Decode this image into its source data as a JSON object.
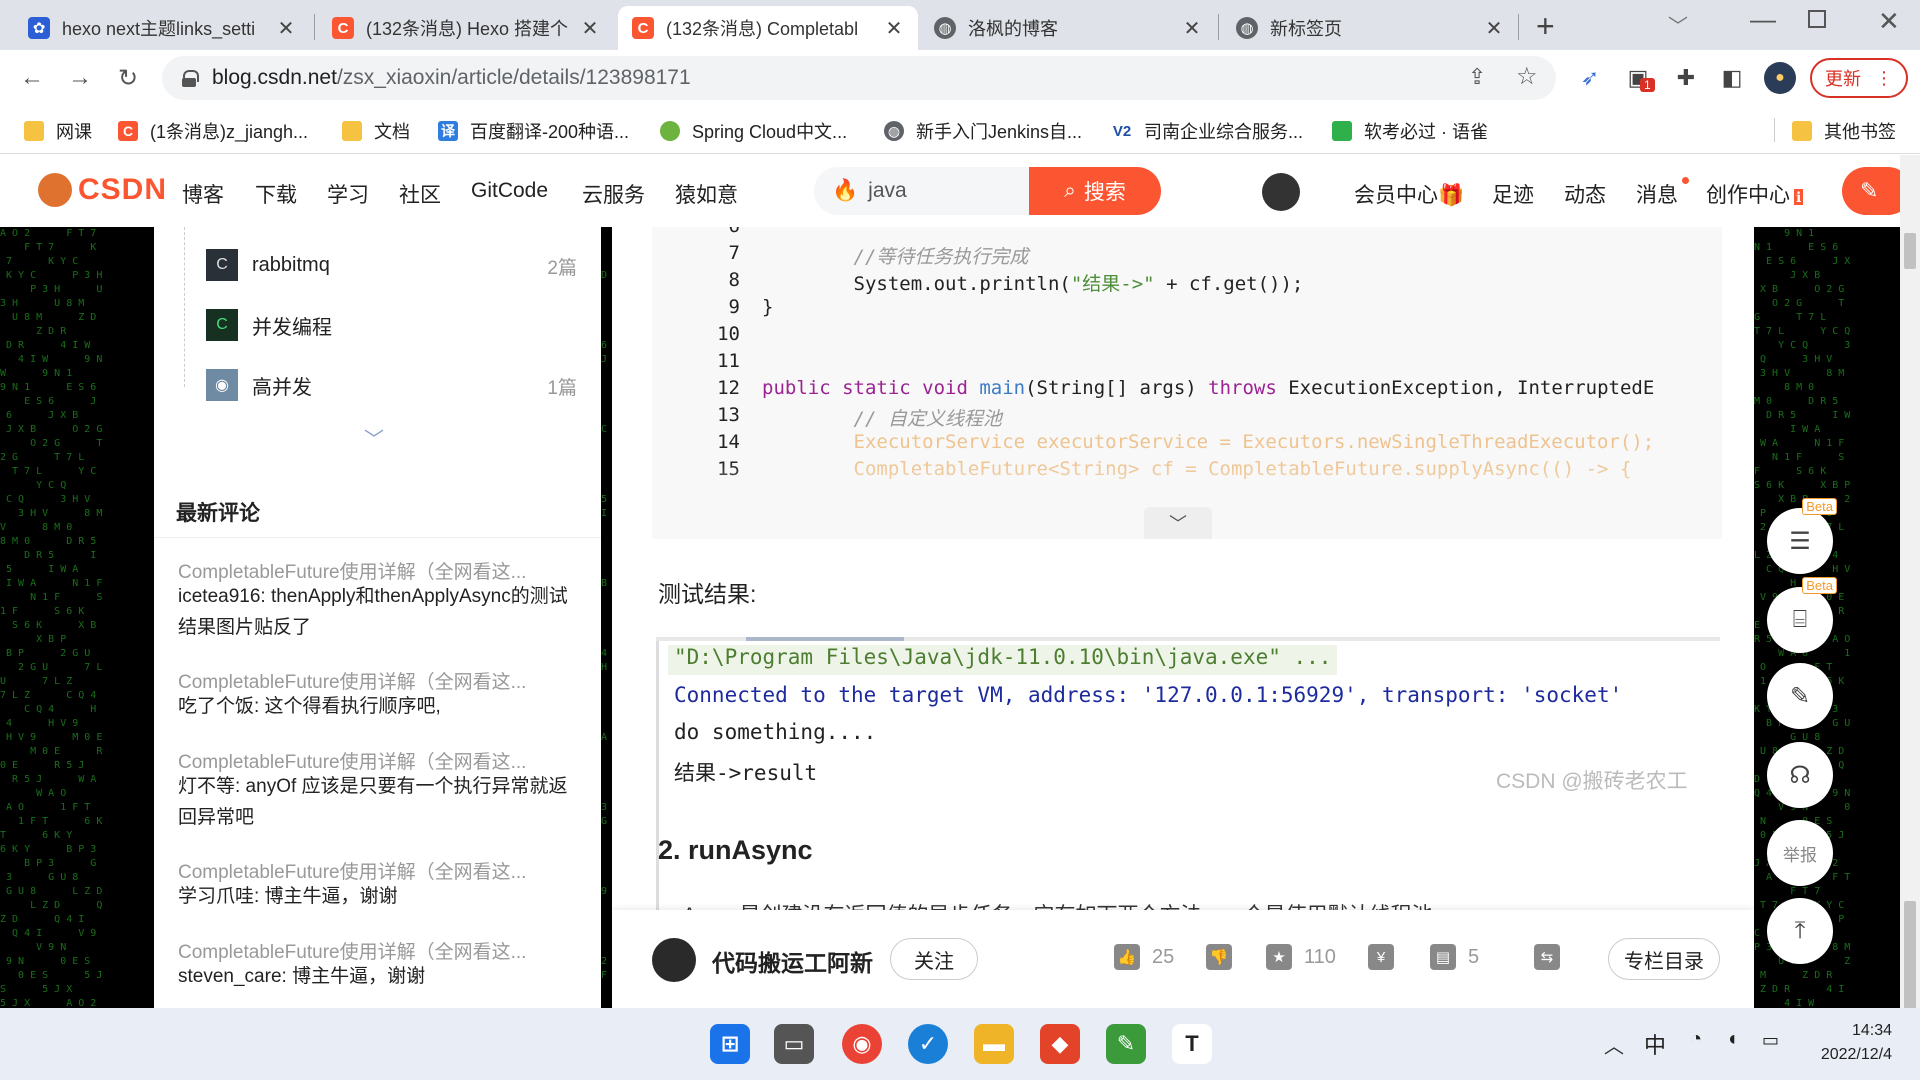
{
  "browser": {
    "tabs": [
      {
        "title": "hexo next主题links_setti",
        "icon": "paw-icon",
        "color": "#2c5fd6"
      },
      {
        "title": "(132条消息) Hexo 搭建个",
        "icon": "csdn-c-icon",
        "color": "#fc5531"
      },
      {
        "title": "(132条消息) Completabl",
        "icon": "csdn-c-icon",
        "color": "#fc5531"
      },
      {
        "title": "洛枫的博客",
        "icon": "globe-icon",
        "color": "#5f6368"
      },
      {
        "title": "新标签页",
        "icon": "globe-icon",
        "color": "#5f6368"
      }
    ],
    "new_tab_label": "+",
    "url_host": "blog.csdn.net",
    "url_path": "/zsx_xiaoxin/article/details/123898171",
    "update_label": "更新",
    "ext_badge": "1",
    "bookmarks": [
      {
        "label": "网课",
        "icon": "folder-icon"
      },
      {
        "label": "(1条消息)z_jiangh...",
        "icon": "csdn-c-icon"
      },
      {
        "label": "文档",
        "icon": "folder-icon"
      },
      {
        "label": "百度翻译-200种语...",
        "icon": "translate-icon"
      },
      {
        "label": "Spring Cloud中文...",
        "icon": "spring-icon"
      },
      {
        "label": "新手入门Jenkins自...",
        "icon": "globe-icon"
      },
      {
        "label": "司南企业综合服务...",
        "icon": "v2-icon"
      },
      {
        "label": "软考必过 · 语雀",
        "icon": "yuque-icon"
      }
    ],
    "other_bookmarks": "其他书签"
  },
  "csdn": {
    "logo": "CSDN",
    "nav": [
      "博客",
      "下载",
      "学习",
      "社区",
      "GitCode",
      "云服务",
      "猿如意"
    ],
    "search_value": "java",
    "search_button": "搜索",
    "right_nav": [
      "会员中心",
      "足迹",
      "动态",
      "消息",
      "创作中心"
    ]
  },
  "sidebar": {
    "columns": [
      {
        "name": "rabbitmq",
        "count": "2篇"
      },
      {
        "name": "并发编程",
        "count": ""
      },
      {
        "name": "高并发",
        "count": "1篇"
      }
    ],
    "comments_title": "最新评论",
    "comments": [
      {
        "article": "CompletableFuture使用详解（全网看这...",
        "text": "icetea916: thenApply和thenApplyAsync的测试结果图片贴反了"
      },
      {
        "article": "CompletableFuture使用详解（全网看这...",
        "text": "吃了个饭: 这个得看执行顺序吧,"
      },
      {
        "article": "CompletableFuture使用详解（全网看这...",
        "text": "灯不等: anyOf 应该是只要有一个执行异常就返回异常吧"
      },
      {
        "article": "CompletableFuture使用详解（全网看这...",
        "text": "学习爪哇: 博主牛逼，谢谢"
      },
      {
        "article": "CompletableFuture使用详解（全网看这...",
        "text": "steven_care: 博主牛逼，谢谢"
      }
    ]
  },
  "article": {
    "code_lines": [
      {
        "n": "6",
        "segs": []
      },
      {
        "n": "7",
        "segs": [
          {
            "t": "        //等待任务执行完成",
            "c": "cmt"
          }
        ]
      },
      {
        "n": "8",
        "segs": [
          {
            "t": "        System.out.println(",
            "c": ""
          },
          {
            "t": "\"结果->\"",
            "c": "str"
          },
          {
            "t": " + cf.get());",
            "c": ""
          }
        ]
      },
      {
        "n": "9",
        "segs": [
          {
            "t": "}",
            "c": ""
          }
        ]
      },
      {
        "n": "10",
        "segs": []
      },
      {
        "n": "11",
        "segs": []
      },
      {
        "n": "12",
        "segs": [
          {
            "t": "public static void ",
            "c": "kw"
          },
          {
            "t": "main",
            "c": "fn"
          },
          {
            "t": "(String[] args) ",
            "c": ""
          },
          {
            "t": "throws",
            "c": "kw"
          },
          {
            "t": " ExecutionException, InterruptedE",
            "c": ""
          }
        ]
      },
      {
        "n": "13",
        "segs": [
          {
            "t": "        // 自定义线程池",
            "c": "cmt"
          }
        ]
      },
      {
        "n": "14",
        "segs": [
          {
            "t": "        ExecutorService executorService = Executors.newSingleThreadExecutor();",
            "c": "fade"
          }
        ]
      },
      {
        "n": "15",
        "segs": [
          {
            "t": "        CompletableFuture<String> cf = CompletableFuture.supplyAsync(() -> {",
            "c": "fade"
          }
        ]
      }
    ],
    "test_result_label": "测试结果:",
    "console_lines": [
      "\"D:\\Program Files\\Java\\jdk-11.0.10\\bin\\java.exe\" ...",
      "Connected to the target VM, address: '127.0.0.1:56929', transport: 'socket'",
      "do something....",
      "结果->result"
    ],
    "watermark": "CSDN @搬砖老农工",
    "section_heading": "2. runAsync",
    "section_text_cut": "runAsync是创建没有返回值的异步任务。它有如下两个方法，一个是使用默认线程池"
  },
  "bottom_bar": {
    "author": "代码搬运工阿新",
    "follow": "关注",
    "likes": "25",
    "favorites": "110",
    "comments": "5",
    "catalog": "专栏目录"
  },
  "float_buttons": {
    "beta": "Beta",
    "report": "举报"
  },
  "taskbar": {
    "ime": "中",
    "time": "14:34",
    "date": "2022/12/4"
  }
}
